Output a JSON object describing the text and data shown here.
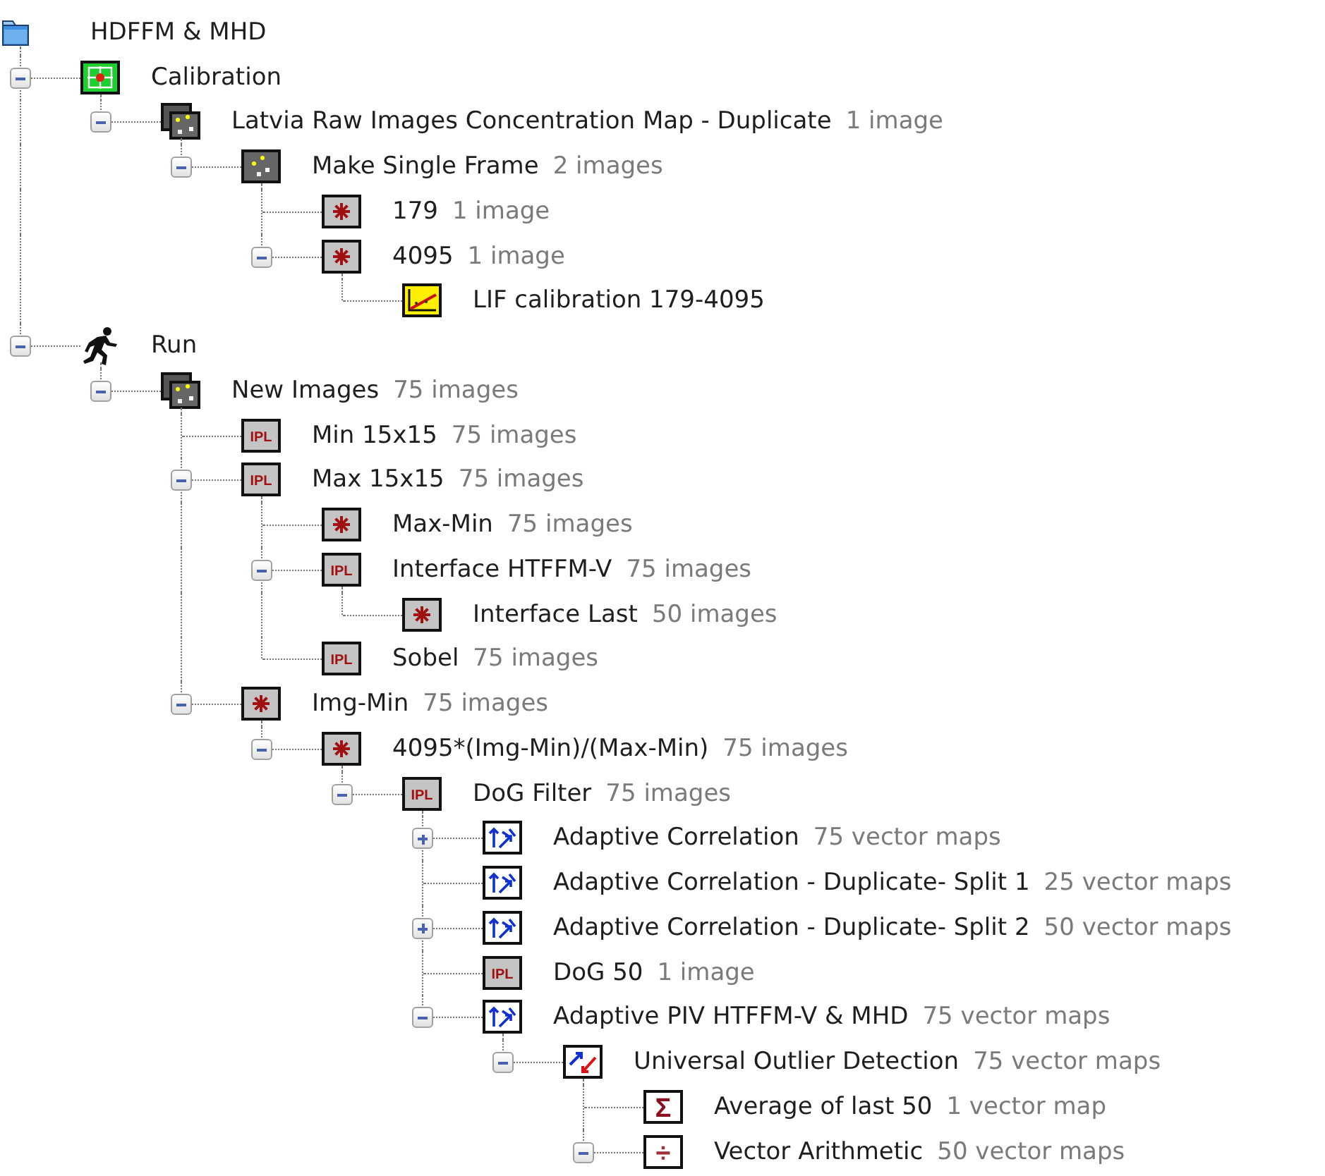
{
  "tree": {
    "label": "HDFFM & MHD",
    "kind": "folder",
    "children": [
      {
        "label": "Calibration",
        "kind": "calibration",
        "expanded": true,
        "children": [
          {
            "label": "Latvia Raw Images Concentration Map - Duplicate",
            "count": "1 image",
            "kind": "image-stack",
            "expanded": true,
            "children": [
              {
                "label": "Make Single Frame",
                "count": "2 images",
                "kind": "image",
                "expanded": true,
                "children": [
                  {
                    "label": "179",
                    "count": "1 image",
                    "kind": "asterisk"
                  },
                  {
                    "label": "4095",
                    "count": "1 image",
                    "kind": "asterisk",
                    "expanded": true,
                    "children": [
                      {
                        "label": "LIF calibration 179-4095",
                        "kind": "chart"
                      }
                    ]
                  }
                ]
              }
            ]
          }
        ]
      },
      {
        "label": "Run",
        "kind": "runner",
        "expanded": true,
        "children": [
          {
            "label": "New Images",
            "count": "75 images",
            "kind": "image-stack",
            "expanded": true,
            "children": [
              {
                "label": "Min 15x15",
                "count": "75 images",
                "kind": "ipl",
                "icon_text": "IPL"
              },
              {
                "label": "Max 15x15",
                "count": "75 images",
                "kind": "ipl",
                "icon_text": "IPL",
                "expanded": true,
                "children": [
                  {
                    "label": "Max-Min",
                    "count": "75 images",
                    "kind": "asterisk"
                  },
                  {
                    "label": "Interface HTFFM-V",
                    "count": "75 images",
                    "kind": "ipl",
                    "icon_text": "IPL",
                    "expanded": true,
                    "children": [
                      {
                        "label": "Interface Last",
                        "count": "50 images",
                        "kind": "asterisk"
                      }
                    ]
                  },
                  {
                    "label": "Sobel",
                    "count": "75 images",
                    "kind": "ipl",
                    "icon_text": "IPL"
                  }
                ]
              },
              {
                "label": "Img-Min",
                "count": "75 images",
                "kind": "asterisk",
                "expanded": true,
                "children": [
                  {
                    "label": "4095*(Img-Min)/(Max-Min)",
                    "count": "75 images",
                    "kind": "asterisk",
                    "expanded": true,
                    "children": [
                      {
                        "label": "DoG Filter",
                        "count": "75 images",
                        "kind": "ipl",
                        "icon_text": "IPL",
                        "expanded": true,
                        "children": [
                          {
                            "label": "Adaptive Correlation",
                            "count": "75 vector maps",
                            "kind": "vector",
                            "expanded": false
                          },
                          {
                            "label": "Adaptive Correlation - Duplicate- Split 1",
                            "count": "25 vector maps",
                            "kind": "vector"
                          },
                          {
                            "label": "Adaptive Correlation - Duplicate- Split 2",
                            "count": "50 vector maps",
                            "kind": "vector",
                            "expanded": false
                          },
                          {
                            "label": "DoG 50",
                            "count": "1 image",
                            "kind": "ipl",
                            "icon_text": "IPL"
                          },
                          {
                            "label": "Adaptive PIV HTFFM-V & MHD",
                            "count": "75 vector maps",
                            "kind": "vector",
                            "expanded": true,
                            "children": [
                              {
                                "label": "Universal Outlier Detection",
                                "count": "75 vector maps",
                                "kind": "outlier",
                                "expanded": true,
                                "children": [
                                  {
                                    "label": "Average of last 50",
                                    "count": "1 vector map",
                                    "kind": "sigma",
                                    "icon_text": "Σ"
                                  },
                                  {
                                    "label": "Vector Arithmetic",
                                    "count": "50 vector maps",
                                    "kind": "divide",
                                    "icon_text": "÷",
                                    "expanded": true
                                  }
                                ]
                              }
                            ]
                          }
                        ]
                      }
                    ]
                  }
                ]
              }
            ]
          }
        ]
      }
    ]
  }
}
